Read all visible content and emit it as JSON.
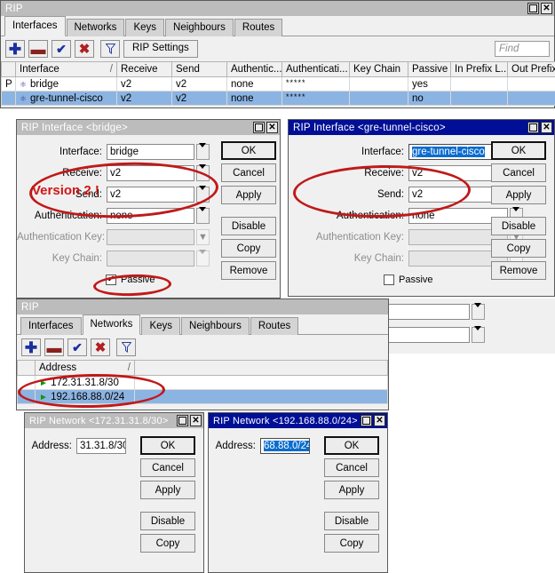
{
  "main_window": {
    "title": "RIP",
    "title_active": false,
    "window_buttons": {
      "maximize": "maximize-icon",
      "close": "close-icon"
    },
    "tabs": [
      {
        "label": "Interfaces",
        "selected": true
      },
      {
        "label": "Networks",
        "selected": false
      },
      {
        "label": "Keys",
        "selected": false
      },
      {
        "label": "Neighbours",
        "selected": false
      },
      {
        "label": "Routes",
        "selected": false
      }
    ],
    "toolbar": {
      "add_label": "+",
      "remove_label": "—",
      "enable_label": "✔",
      "disable_label": "✖",
      "filter_label": "filter-icon",
      "settings_label": "RIP Settings",
      "find_placeholder": "Find"
    },
    "table": {
      "columns": [
        "",
        "Interface",
        "Receive",
        "Send",
        "Authentic...",
        "Authenticati...",
        "Key Chain",
        "Passive",
        "In Prefix L...",
        "Out Prefix...",
        "▼"
      ],
      "sort_indicator": "/",
      "rows": [
        {
          "flag": "P",
          "interface": "bridge",
          "receive": "v2",
          "send": "v2",
          "authentication": "none",
          "authentication_key": "*****",
          "key_chain": "",
          "passive": "yes",
          "in_prefix_list": "",
          "out_prefix_list": "",
          "selected": false
        },
        {
          "flag": "",
          "interface": "gre-tunnel-cisco",
          "receive": "v2",
          "send": "v2",
          "authentication": "none",
          "authentication_key": "*****",
          "key_chain": "",
          "passive": "no",
          "in_prefix_list": "",
          "out_prefix_list": "",
          "selected": true
        }
      ]
    }
  },
  "interface_dialog_bridge": {
    "title": "RIP Interface <bridge>",
    "title_active": false,
    "fields": {
      "interface_label": "Interface:",
      "interface_value": "bridge",
      "receive_label": "Receive:",
      "receive_value": "v2",
      "send_label": "Send:",
      "send_value": "v2",
      "authentication_label": "Authentication:",
      "authentication_value": "none",
      "auth_key_label": "Authentication Key:",
      "auth_key_value": "",
      "key_chain_label": "Key Chain:",
      "key_chain_value": "",
      "passive_label": "Passive",
      "passive_checked": true
    },
    "buttons": [
      "OK",
      "Cancel",
      "Apply",
      "Disable",
      "Copy",
      "Remove"
    ]
  },
  "interface_dialog_gre": {
    "title": "RIP Interface <gre-tunnel-cisco>",
    "title_active": true,
    "fields": {
      "interface_label": "Interface:",
      "interface_value": "gre-tunnel-cisco",
      "receive_label": "Receive:",
      "receive_value": "v2",
      "send_label": "Send:",
      "send_value": "v2",
      "authentication_label": "Authentication:",
      "authentication_value": "none",
      "auth_key_label": "Authentication Key:",
      "auth_key_value": "",
      "key_chain_label": "Key Chain:",
      "key_chain_value": "",
      "passive_label": "Passive",
      "passive_checked": false
    },
    "buttons": [
      "OK",
      "Cancel",
      "Apply",
      "Disable",
      "Copy",
      "Remove"
    ]
  },
  "networks_window": {
    "title": "RIP",
    "title_active": false,
    "tabs": [
      {
        "label": "Interfaces",
        "selected": false
      },
      {
        "label": "Networks",
        "selected": true
      },
      {
        "label": "Keys",
        "selected": false
      },
      {
        "label": "Neighbours",
        "selected": false
      },
      {
        "label": "Routes",
        "selected": false
      }
    ],
    "toolbar": {
      "add_label": "+",
      "remove_label": "—",
      "enable_label": "✔",
      "disable_label": "✖",
      "filter_label": "filter-icon"
    },
    "table": {
      "columns": [
        "",
        "Address",
        ""
      ],
      "sort_indicator": "/",
      "rows": [
        {
          "address": "172.31.31.8/30",
          "selected": false
        },
        {
          "address": "192.168.88.0/24",
          "selected": true
        }
      ]
    }
  },
  "network_dialog_1": {
    "title": "RIP Network <172.31.31.8/30>",
    "title_active": false,
    "address_label": "Address:",
    "address_value": "31.31.8/30",
    "address_selected": false,
    "buttons": [
      "OK",
      "Cancel",
      "Apply",
      "Disable",
      "Copy"
    ]
  },
  "network_dialog_2": {
    "title": "RIP Network <192.168.88.0/24>",
    "title_active": true,
    "address_label": "Address:",
    "address_value": "68.88.0/24",
    "address_selected": true,
    "buttons": [
      "OK",
      "Cancel",
      "Apply",
      "Disable",
      "Copy"
    ]
  },
  "annotations": {
    "version_note": "Version 2 !",
    "accent_color": "#c01919"
  },
  "colors": {
    "titlebar_active": "#000f96",
    "titlebar_inactive": "#bcbcbc",
    "row_selected": "#8cb4e2",
    "window_face": "#f0f0f0",
    "annotation_red": "#c01919"
  }
}
